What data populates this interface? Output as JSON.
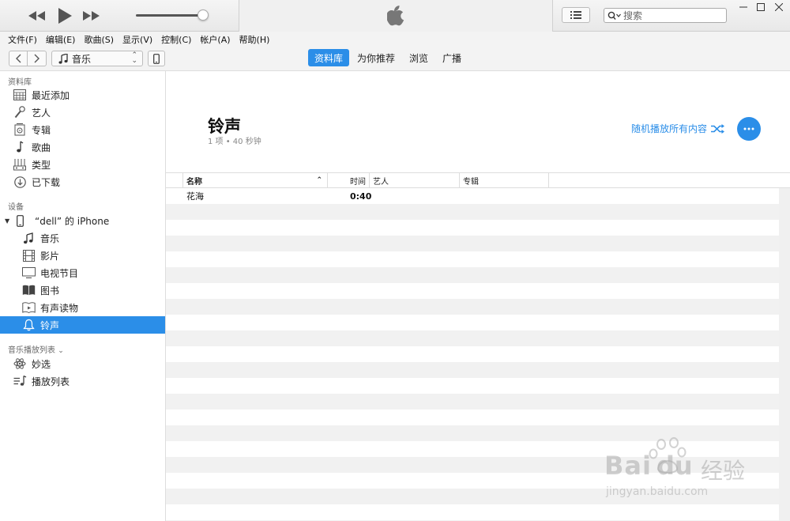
{
  "search": {
    "placeholder": "搜索"
  },
  "menu": [
    "文件(F)",
    "编辑(E)",
    "歌曲(S)",
    "显示(V)",
    "控制(C)",
    "帐户(A)",
    "帮助(H)"
  ],
  "media_kind": "音乐",
  "tabs": [
    "资料库",
    "为你推荐",
    "浏览",
    "广播"
  ],
  "sidebar": {
    "library_header": "资料库",
    "library": [
      "最近添加",
      "艺人",
      "专辑",
      "歌曲",
      "类型",
      "已下载"
    ],
    "devices_header": "设备",
    "device_name": "“dell” 的 iPhone",
    "device_items": [
      "音乐",
      "影片",
      "电视节目",
      "图书",
      "有声读物",
      "铃声"
    ],
    "playlists_header": "音乐播放列表",
    "playlists": [
      "妙选",
      "播放列表"
    ]
  },
  "main": {
    "title": "铃声",
    "subtitle": "1 项 • 40 秒钟",
    "shuffle_label": "随机播放所有内容",
    "columns": [
      "名称",
      "时间",
      "艺人",
      "专辑"
    ],
    "rows": [
      {
        "name": "花海",
        "time": "0:40",
        "artist": "",
        "album": ""
      }
    ]
  },
  "watermark": {
    "brand": "Bai",
    "brand2": "du",
    "cn": "经验",
    "url": "jingyan.baidu.com"
  },
  "colors": {
    "accent": "#2b8ee8"
  }
}
